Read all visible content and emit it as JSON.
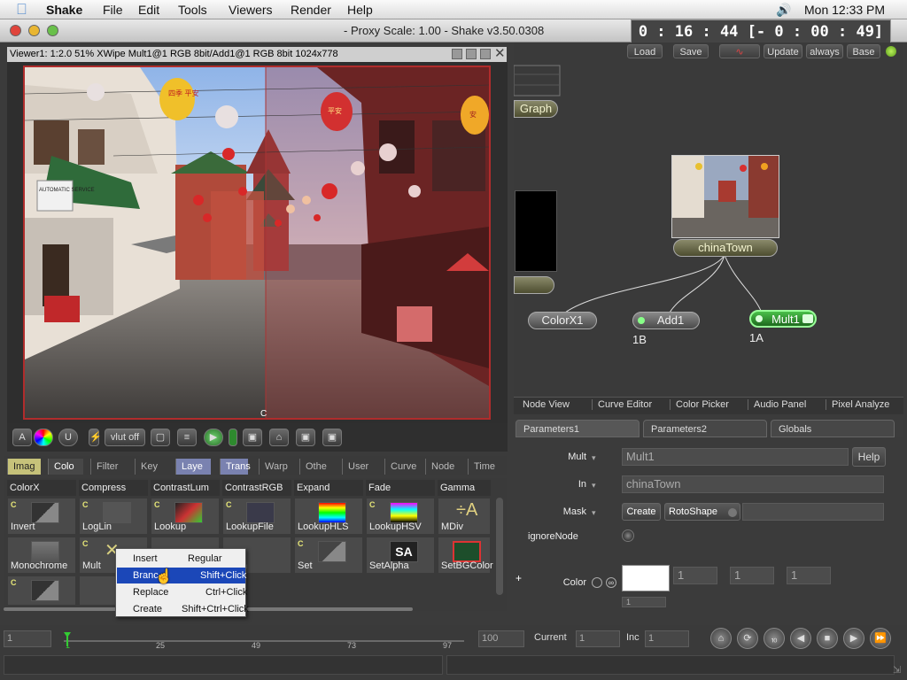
{
  "menubar": {
    "app": "Shake",
    "items": [
      "File",
      "Edit",
      "Tools",
      "Viewers",
      "Render",
      "Help"
    ],
    "clock": "Mon 12:33 PM"
  },
  "window": {
    "title": "- Proxy Scale: 1.00 - Shake v3.50.0308",
    "timer": "0 : 16 : 44  [- 0 : 00 : 49]  (95%)"
  },
  "viewer": {
    "header": "Viewer1: 1:2.0  51% XWipe Mult1@1 RGB 8bit/Add1@1 RGB 8bit 1024x778",
    "marker": "C",
    "toolbar": {
      "a_label": "A",
      "u_label": "U",
      "vlut_label": "vlut off"
    },
    "photo_signs": {
      "lantern1": "四季\n平安",
      "lantern2": "平安",
      "lantern3": "安",
      "shop": "AUTOMATIC\nSERVICE"
    }
  },
  "tool_tabs": [
    "Imag",
    "Colo",
    "Filter",
    "Key",
    "Laye",
    "Trans",
    "Warp",
    "Othe",
    "User",
    "Curve",
    "Node",
    "Time"
  ],
  "tool_headers": [
    "ColorX",
    "Compress",
    "ContrastLum",
    "ContrastRGB",
    "Expand",
    "Fade",
    "Gamma"
  ],
  "tool_cells": [
    {
      "label": "Invert",
      "c": true
    },
    {
      "label": "LogLin",
      "c": true
    },
    {
      "label": "Lookup",
      "c": true
    },
    {
      "label": "LookupFile",
      "c": true
    },
    {
      "label": "LookupHLS",
      "c": false
    },
    {
      "label": "LookupHSV",
      "c": true
    },
    {
      "label": "MDiv",
      "c": false
    },
    {
      "label": "Monochrome",
      "c": false
    },
    {
      "label": "Mult",
      "c": true
    },
    {
      "label": "",
      "c": false
    },
    {
      "label": "ation",
      "c": false
    },
    {
      "label": "Set",
      "c": true
    },
    {
      "label": "SetAlpha",
      "c": false
    },
    {
      "label": "SetBGColor",
      "c": false
    },
    {
      "label": "",
      "c": true
    },
    {
      "label": "",
      "c": false
    }
  ],
  "context_menu": [
    {
      "label": "Insert",
      "shortcut": "Regular Click"
    },
    {
      "label": "Branc",
      "shortcut": "Shift+Click",
      "selected": true
    },
    {
      "label": "Replace",
      "shortcut": "Ctrl+Click"
    },
    {
      "label": "Create",
      "shortcut": "Shift+Ctrl+Click"
    }
  ],
  "right_toolbar": {
    "load": "Load",
    "save": "Save",
    "update": "Update",
    "always": "always",
    "base": "Base"
  },
  "nodes": {
    "graph": "Graph",
    "chinatown": "chinaTown",
    "colorx1": "ColorX1",
    "add1": "Add1",
    "mult1": "Mult1",
    "add1_tag": "1B",
    "mult1_tag": "1A"
  },
  "node_tabs": [
    "Node View",
    "Curve Editor",
    "Color Picker",
    "Audio Panel",
    "Pixel Analyze"
  ],
  "param_tabs": [
    "Parameters1",
    "Parameters2",
    "Globals"
  ],
  "params": {
    "mult_label": "Mult",
    "mult_value": "Mult1",
    "help": "Help",
    "in_label": "In",
    "in_value": "chinaTown",
    "mask_label": "Mask",
    "create": "Create",
    "rotoshape": "RotoShape",
    "ignore_label": "ignoreNode",
    "color_label": "Color",
    "color_r": "1",
    "color_g": "1",
    "color_b": "1",
    "plus": "+",
    "partial": "1"
  },
  "timeline": {
    "start": "1",
    "end": "100",
    "current_label": "Current",
    "current": "1",
    "inc_label": "Inc",
    "inc": "1",
    "ticks": [
      "1",
      "25",
      "49",
      "73",
      "97"
    ]
  },
  "colors": {
    "accent": "#1b47b8",
    "node_green": "#3ba53b",
    "viewer_border": "#b02c2c"
  }
}
